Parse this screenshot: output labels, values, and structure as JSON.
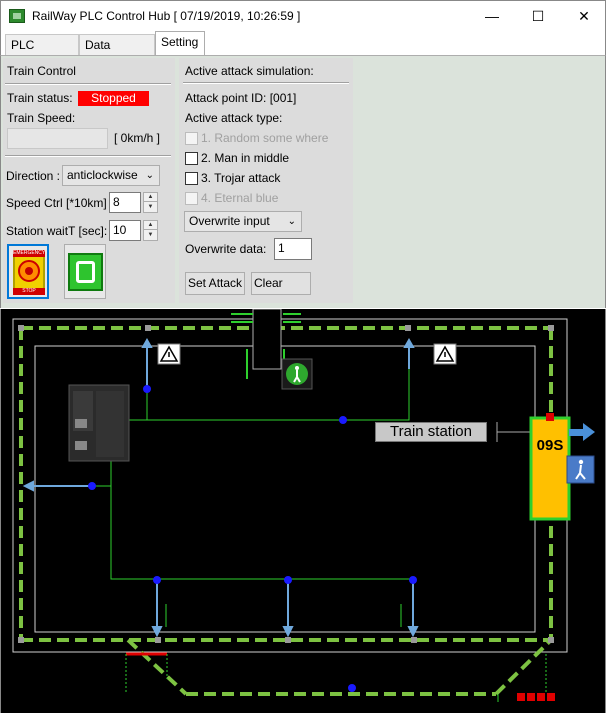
{
  "window": {
    "title": "RailWay PLC Control Hub [ 07/19/2019, 10:26:59 ]",
    "min_label": "—",
    "max_label": "☐",
    "close_label": "✕"
  },
  "tabs": [
    {
      "label": "PLC control"
    },
    {
      "label": "Data Display"
    },
    {
      "label": "Setting"
    }
  ],
  "train_control": {
    "header": "Train Control",
    "status_label": "Train status:",
    "status_value": "Stopped",
    "speed_label": "Train Speed:",
    "speed_value": "[ 0km/h ]",
    "direction_label": "Direction :",
    "direction_value": "anticlockwise",
    "speed_ctrl_label": "Speed Ctrl [*10km]",
    "speed_ctrl_value": "8",
    "station_wait_label": "Station waitT [sec]:",
    "station_wait_value": "10",
    "emergency_top": "EMERGENCY",
    "emergency_bottom": "STOP"
  },
  "attack": {
    "header": "Active attack simulation:",
    "point_id": "Attack point ID: [001]",
    "type_label": "Active attack type:",
    "types": [
      {
        "label": "1. Random some where",
        "enabled": false,
        "checked": false
      },
      {
        "label": "2. Man in middle",
        "enabled": true,
        "checked": false
      },
      {
        "label": "3. Trojar attack",
        "enabled": true,
        "checked": false
      },
      {
        "label": "4. Eternal blue",
        "enabled": false,
        "checked": false
      }
    ],
    "mode_value": "Overwrite input",
    "overwrite_label": "Overwrite data:",
    "overwrite_value": "1",
    "set_button": "Set Attack",
    "clear_button": "Clear"
  },
  "track": {
    "station_label": "Train station",
    "timer": "09S",
    "colors": {
      "rail": "#7dc242",
      "wire": "#2ed02e",
      "node": "#1a1aff",
      "sensor": "#6fa8dc",
      "station": "#ffc000"
    }
  }
}
